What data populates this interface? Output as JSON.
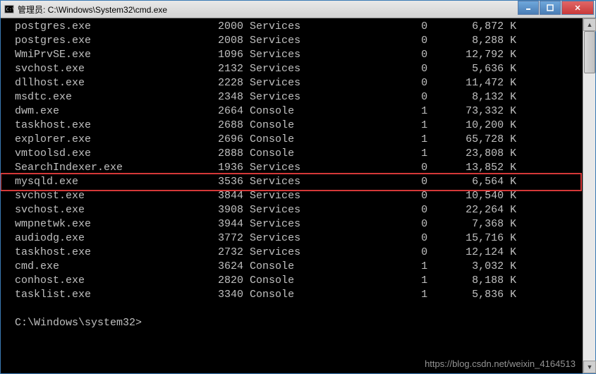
{
  "window": {
    "title": "管理员: C:\\Windows\\System32\\cmd.exe"
  },
  "processes": [
    {
      "name": "postgres.exe",
      "pid": "2000",
      "sess": "Services",
      "id": "0",
      "mem": "6,872",
      "unit": "K"
    },
    {
      "name": "postgres.exe",
      "pid": "2008",
      "sess": "Services",
      "id": "0",
      "mem": "8,288",
      "unit": "K"
    },
    {
      "name": "WmiPrvSE.exe",
      "pid": "1096",
      "sess": "Services",
      "id": "0",
      "mem": "12,792",
      "unit": "K"
    },
    {
      "name": "svchost.exe",
      "pid": "2132",
      "sess": "Services",
      "id": "0",
      "mem": "5,636",
      "unit": "K"
    },
    {
      "name": "dllhost.exe",
      "pid": "2228",
      "sess": "Services",
      "id": "0",
      "mem": "11,472",
      "unit": "K"
    },
    {
      "name": "msdtc.exe",
      "pid": "2348",
      "sess": "Services",
      "id": "0",
      "mem": "8,132",
      "unit": "K"
    },
    {
      "name": "dwm.exe",
      "pid": "2664",
      "sess": "Console",
      "id": "1",
      "mem": "73,332",
      "unit": "K"
    },
    {
      "name": "taskhost.exe",
      "pid": "2688",
      "sess": "Console",
      "id": "1",
      "mem": "10,200",
      "unit": "K"
    },
    {
      "name": "explorer.exe",
      "pid": "2696",
      "sess": "Console",
      "id": "1",
      "mem": "65,728",
      "unit": "K"
    },
    {
      "name": "vmtoolsd.exe",
      "pid": "2888",
      "sess": "Console",
      "id": "1",
      "mem": "23,808",
      "unit": "K"
    },
    {
      "name": "SearchIndexer.exe",
      "pid": "1936",
      "sess": "Services",
      "id": "0",
      "mem": "13,852",
      "unit": "K"
    },
    {
      "name": "mysqld.exe",
      "pid": "3536",
      "sess": "Services",
      "id": "0",
      "mem": "6,564",
      "unit": "K"
    },
    {
      "name": "svchost.exe",
      "pid": "3844",
      "sess": "Services",
      "id": "0",
      "mem": "10,540",
      "unit": "K"
    },
    {
      "name": "svchost.exe",
      "pid": "3908",
      "sess": "Services",
      "id": "0",
      "mem": "22,264",
      "unit": "K"
    },
    {
      "name": "wmpnetwk.exe",
      "pid": "3944",
      "sess": "Services",
      "id": "0",
      "mem": "7,368",
      "unit": "K"
    },
    {
      "name": "audiodg.exe",
      "pid": "3772",
      "sess": "Services",
      "id": "0",
      "mem": "15,716",
      "unit": "K"
    },
    {
      "name": "taskhost.exe",
      "pid": "2732",
      "sess": "Services",
      "id": "0",
      "mem": "12,124",
      "unit": "K"
    },
    {
      "name": "cmd.exe",
      "pid": "3624",
      "sess": "Console",
      "id": "1",
      "mem": "3,032",
      "unit": "K"
    },
    {
      "name": "conhost.exe",
      "pid": "2820",
      "sess": "Console",
      "id": "1",
      "mem": "8,188",
      "unit": "K"
    },
    {
      "name": "tasklist.exe",
      "pid": "3340",
      "sess": "Console",
      "id": "1",
      "mem": "5,836",
      "unit": "K"
    }
  ],
  "highlightIndex": 11,
  "prompt": "C:\\Windows\\system32>",
  "watermark": "https://blog.csdn.net/weixin_4164513"
}
